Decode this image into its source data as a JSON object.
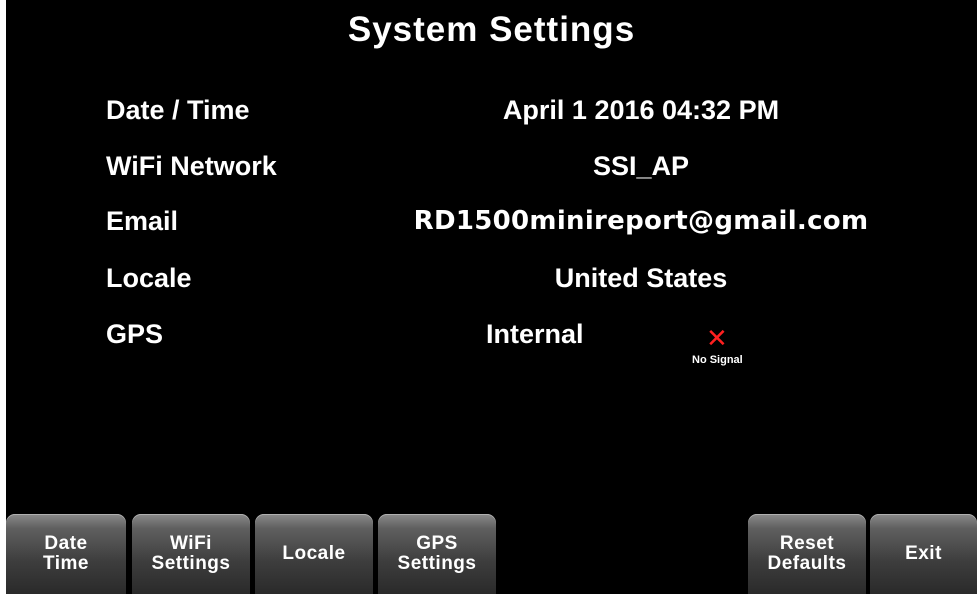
{
  "title": "System Settings",
  "settings": [
    {
      "label": "Date / Time",
      "value": "April 1 2016 04:32 PM"
    },
    {
      "label": "WiFi Network",
      "value": "SSI_AP"
    },
    {
      "label": "Email",
      "value": "RD1500minireport@gmail.com"
    },
    {
      "label": "Locale",
      "value": "United States"
    },
    {
      "label": "GPS",
      "value": "Internal"
    }
  ],
  "gps_status": {
    "icon": "red-x-icon",
    "glyph": "✕",
    "text": "No Signal",
    "color": "#ff2020"
  },
  "softkeys": [
    {
      "line1": "Date",
      "line2": "Time"
    },
    {
      "line1": "WiFi",
      "line2": "Settings"
    },
    {
      "line1": "Locale",
      "line2": ""
    },
    {
      "line1": "GPS",
      "line2": "Settings"
    },
    {
      "line1": "Reset",
      "line2": "Defaults"
    },
    {
      "line1": "Exit",
      "line2": ""
    }
  ]
}
